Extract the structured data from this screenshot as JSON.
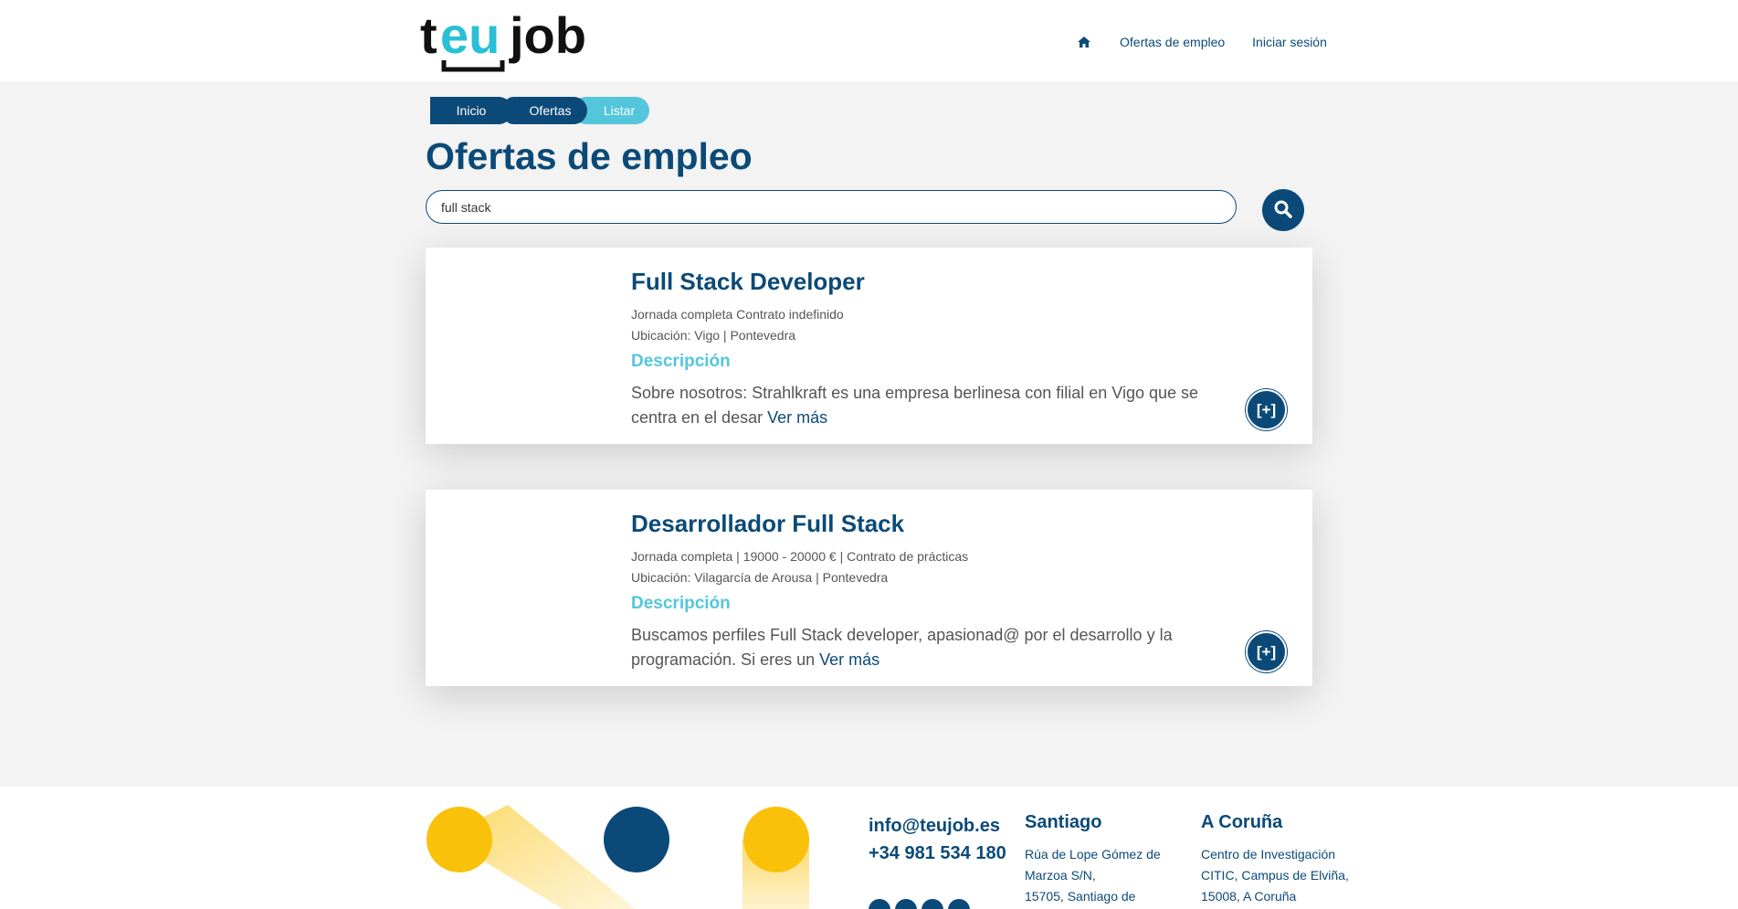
{
  "header": {
    "logo_text_1": "te",
    "logo_text_2": "u",
    "logo_text_3": "job",
    "nav": {
      "home_icon": "home-icon",
      "offers": "Ofertas de empleo",
      "login": "Iniciar sesión"
    }
  },
  "breadcrumb": [
    "Inicio",
    "Ofertas",
    "Listar"
  ],
  "page_title": "Ofertas de empleo",
  "search": {
    "value": "full stack",
    "icon": "search-icon"
  },
  "jobs": [
    {
      "title": "Full Stack Developer",
      "meta": "Jornada completa Contrato indefinido",
      "location": "Ubicación: Vigo | Pontevedra",
      "desc_heading": "Descripción",
      "desc": "Sobre nosotros: Strahlkraft es una empresa berlinesa con filial en Vigo que se centra en el desar",
      "more": "Ver más",
      "plus": "[+]"
    },
    {
      "title": "Desarrollador Full Stack",
      "meta": "Jornada completa | 19000 - 20000 € | Contrato de prácticas",
      "location": "Ubicación: Vilagarcía de Arousa | Pontevedra",
      "desc_heading": "Descripción",
      "desc": "Buscamos perfiles Full Stack developer, apasionad@ por el desarrollo y la programación. Si eres un",
      "more": "Ver más",
      "plus": "[+]"
    }
  ],
  "footer": {
    "email": "info@teujob.es",
    "phone": "+34 981 534 180",
    "social_icons": [
      "x-icon",
      "linkedin-icon",
      "facebook-icon",
      "youtube-icon"
    ],
    "santiago": {
      "title": "Santiago",
      "line1": "Rúa de Lope Gómez de",
      "line2": "Marzoa S/N,",
      "line3": "15705, Santiago de"
    },
    "coruna": {
      "title": "A Coruña",
      "line1": "Centro de Investigación",
      "line2": "CITIC, Campus de Elviña,",
      "line3": "15008, A Coruña"
    }
  },
  "colors": {
    "brand_dark": "#0b4a78",
    "brand_light": "#54c6dc",
    "accent_yellow": "#f9c10a"
  }
}
